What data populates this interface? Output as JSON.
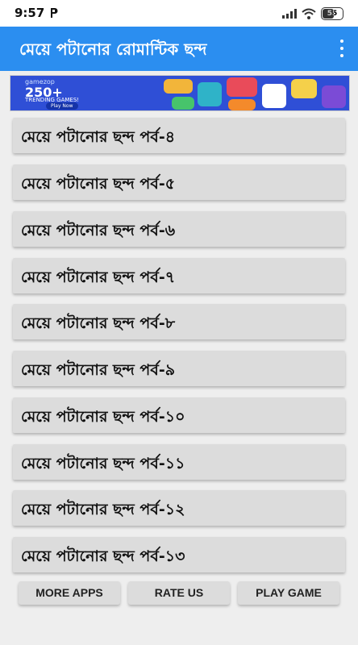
{
  "status": {
    "time": "9:57",
    "battery": "55",
    "notification_icon": "p-notification-icon"
  },
  "appbar": {
    "title": "মেয়ে পটানোর রোমান্টিক ছন্দ"
  },
  "ad": {
    "brand": "gamezop",
    "headline": "250+",
    "subline": "TRENDING GAMES!",
    "cta": "Play Now"
  },
  "items": [
    {
      "label": "মেয়ে পটানোর ছন্দ পর্ব-৪"
    },
    {
      "label": "মেয়ে পটানোর ছন্দ পর্ব-৫"
    },
    {
      "label": "মেয়ে পটানোর ছন্দ পর্ব-৬"
    },
    {
      "label": "মেয়ে পটানোর ছন্দ পর্ব-৭"
    },
    {
      "label": "মেয়ে পটানোর ছন্দ পর্ব-৮"
    },
    {
      "label": "মেয়ে পটানোর ছন্দ পর্ব-৯"
    },
    {
      "label": "মেয়ে পটানোর ছন্দ পর্ব-১০"
    },
    {
      "label": "মেয়ে পটানোর ছন্দ পর্ব-১১"
    },
    {
      "label": "মেয়ে পটানোর ছন্দ পর্ব-১২"
    },
    {
      "label": "মেয়ে পটানোর ছন্দ পর্ব-১৩"
    }
  ],
  "buttons": {
    "more_apps": "MORE APPS",
    "rate_us": "RATE US",
    "play_game": "PLAY GAME"
  },
  "colors": {
    "appbar": "#2b8ef0",
    "item_bg": "#dcdcdc",
    "page_bg": "#eeeeee"
  }
}
